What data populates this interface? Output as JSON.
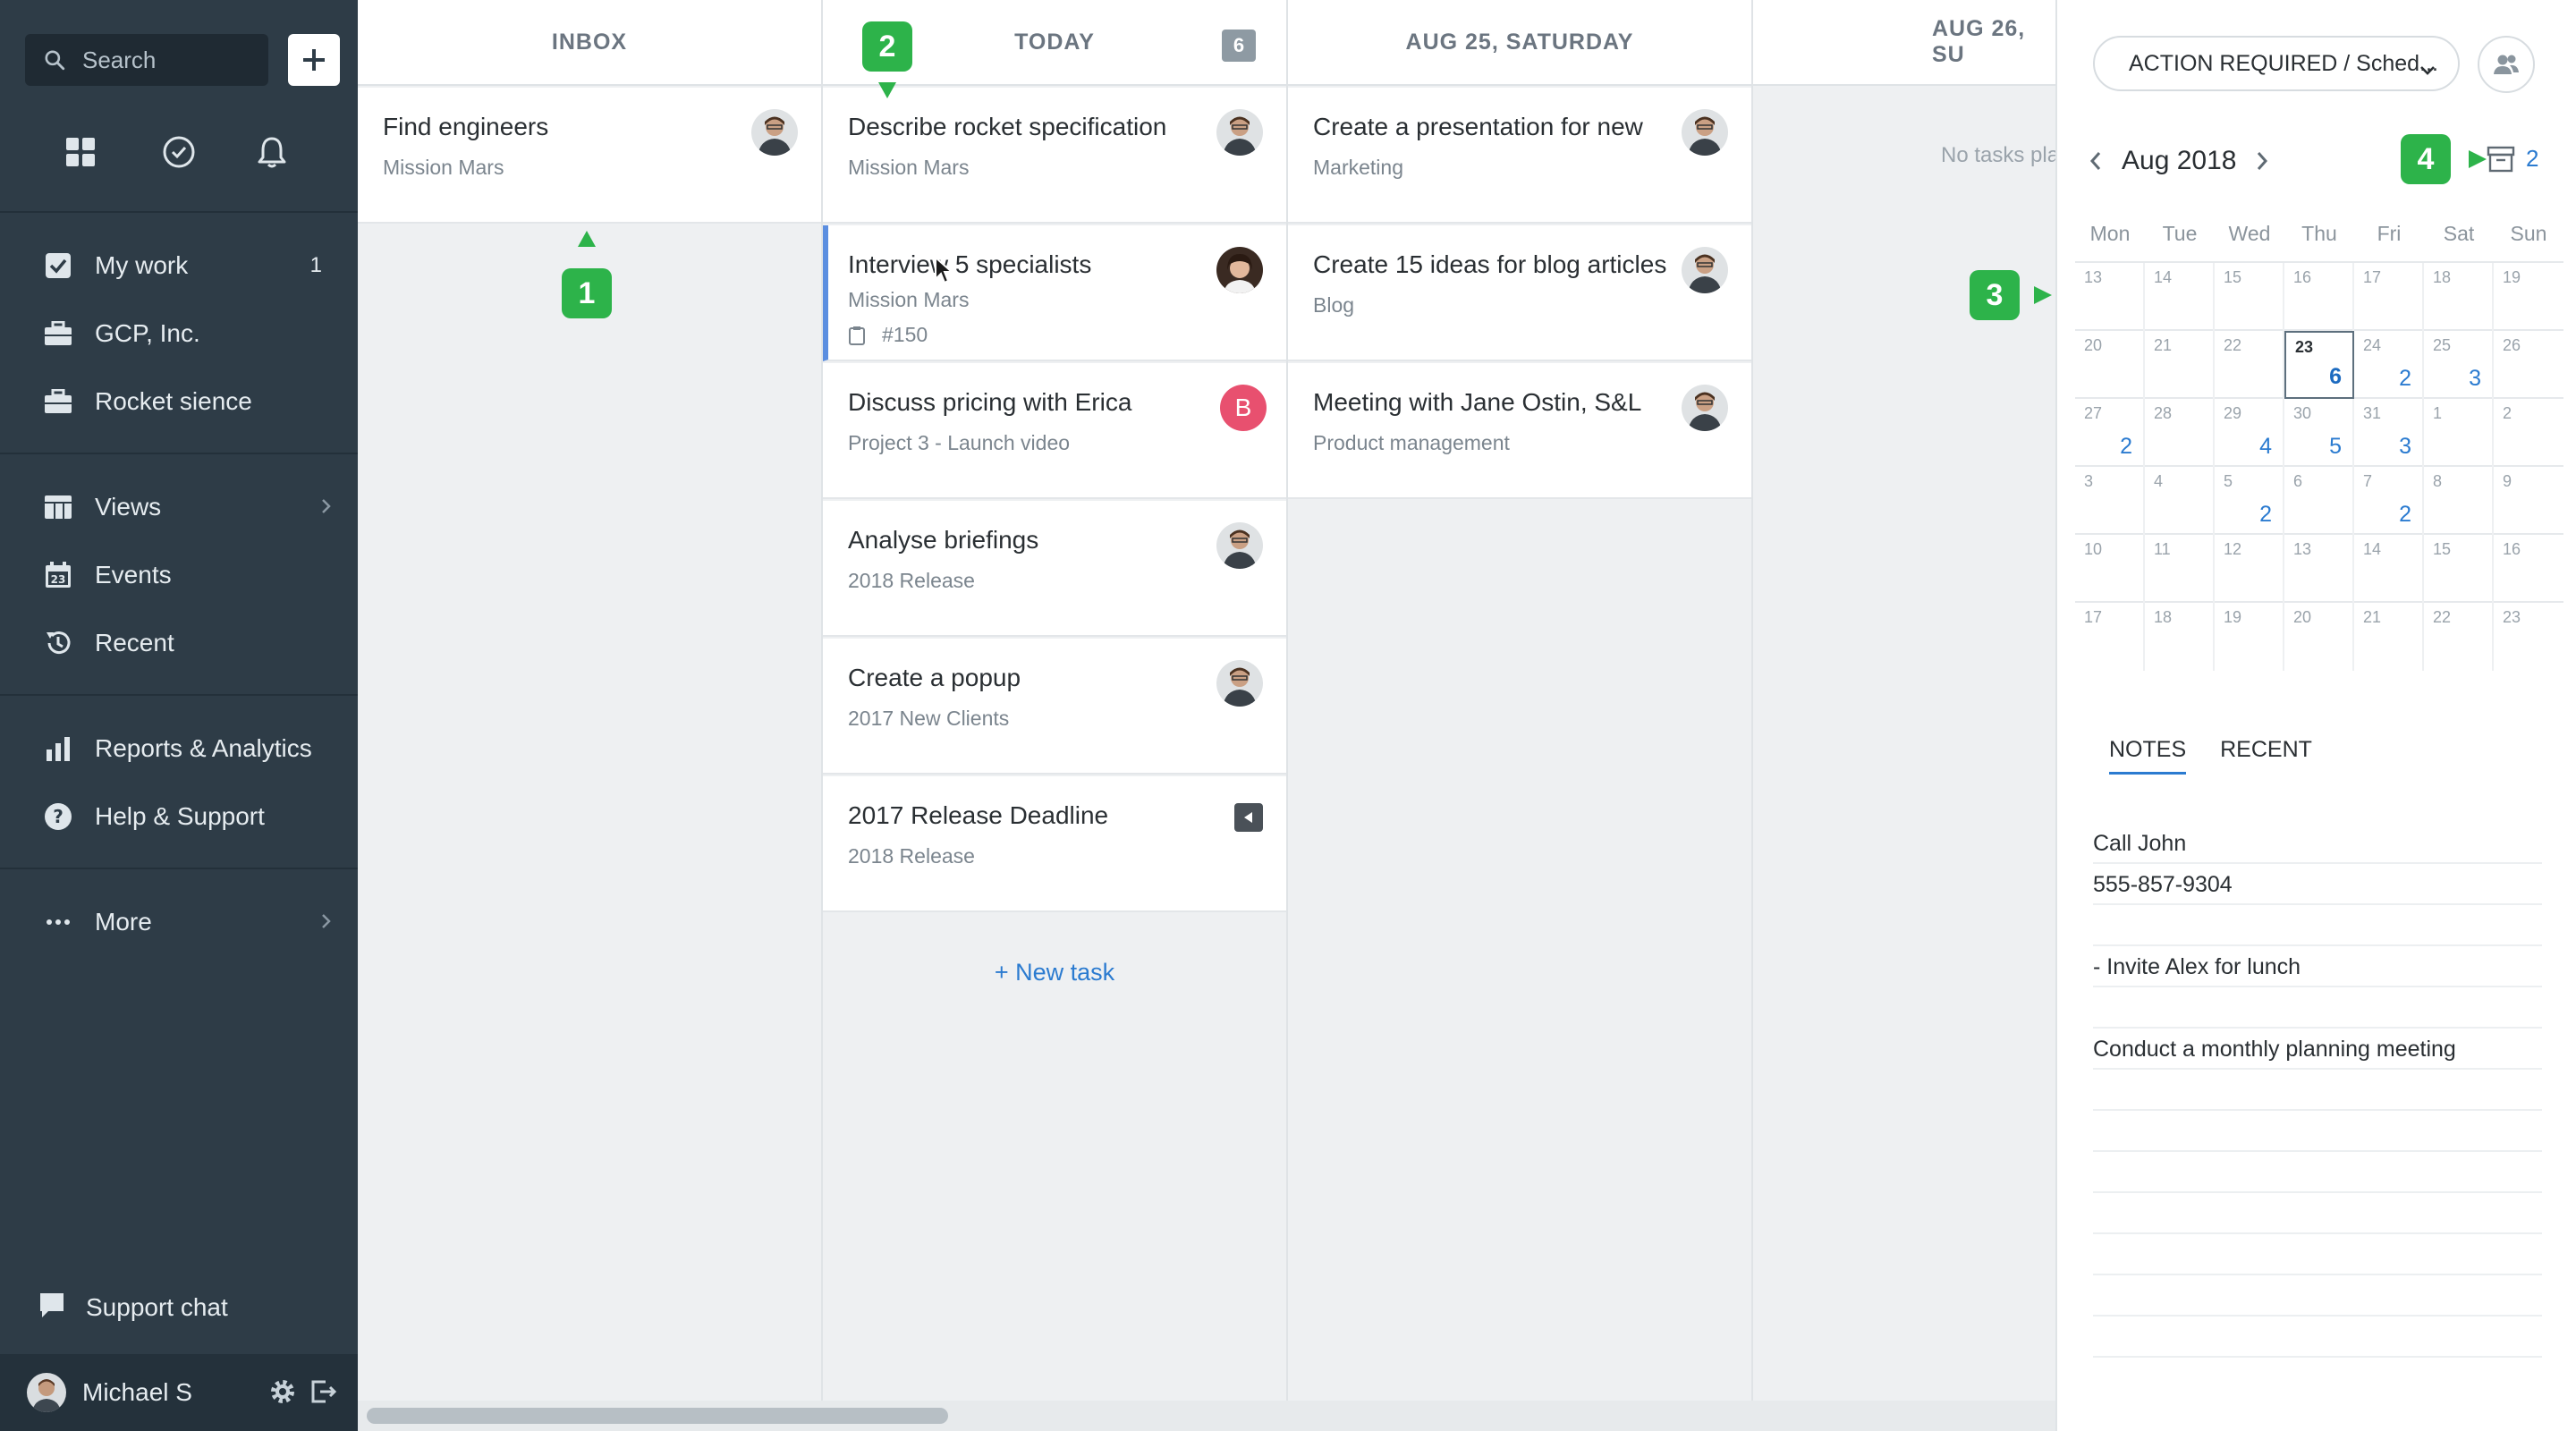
{
  "sidebar": {
    "search_placeholder": "Search",
    "nav": [
      {
        "label": "My work",
        "count": "1"
      },
      {
        "label": "GCP, Inc."
      },
      {
        "label": "Rocket sience"
      },
      {
        "label": "Views"
      },
      {
        "label": "Events"
      },
      {
        "label": "Recent"
      },
      {
        "label": "Reports & Analytics"
      },
      {
        "label": "Help & Support"
      },
      {
        "label": "More"
      }
    ],
    "support_chat": "Support chat",
    "user_name": "Michael S"
  },
  "board": {
    "columns": [
      {
        "title": "INBOX"
      },
      {
        "title": "TODAY",
        "count": "6"
      },
      {
        "title": "AUG 25, SATURDAY"
      },
      {
        "title": "AUG 26, SU"
      }
    ],
    "inbox_cards": [
      {
        "title": "Find engineers",
        "project": "Mission Mars"
      }
    ],
    "today_cards": [
      {
        "title": "Describe rocket specification",
        "project": "Mission Mars"
      },
      {
        "title": "Interview 5 specialists",
        "project": "Mission Mars",
        "id": "#150"
      },
      {
        "title": "Discuss pricing with Erica",
        "project": "Project 3 - Launch video",
        "avatar_letter": "B"
      },
      {
        "title": "Analyse briefings",
        "project": "2018 Release"
      },
      {
        "title": "Create a popup",
        "project": "2017 New Clients"
      },
      {
        "title": "2017 Release Deadline",
        "project": "2018 Release"
      }
    ],
    "saturday_cards": [
      {
        "title": "Create a presentation for new",
        "project": "Marketing"
      },
      {
        "title": "Create 15 ideas for blog articles",
        "project": "Blog"
      },
      {
        "title": "Meeting with Jane Ostin, S&L",
        "project": "Product management"
      }
    ],
    "sunday_empty": "No tasks pla",
    "new_task": "+ New task",
    "markers": [
      "1",
      "2",
      "3",
      "4"
    ]
  },
  "panel": {
    "filter_label": "ACTION REQUIRED / Sched...",
    "month": "Aug 2018",
    "archive_count": "2",
    "weekdays": [
      "Mon",
      "Tue",
      "Wed",
      "Thu",
      "Fri",
      "Sat",
      "Sun"
    ],
    "weeks": [
      [
        {
          "d": "13"
        },
        {
          "d": "14"
        },
        {
          "d": "15"
        },
        {
          "d": "16"
        },
        {
          "d": "17"
        },
        {
          "d": "18"
        },
        {
          "d": "19"
        }
      ],
      [
        {
          "d": "20"
        },
        {
          "d": "21"
        },
        {
          "d": "22"
        },
        {
          "d": "23",
          "n": "6",
          "today": true
        },
        {
          "d": "24",
          "n": "2"
        },
        {
          "d": "25",
          "n": "3"
        },
        {
          "d": "26"
        }
      ],
      [
        {
          "d": "27",
          "n": "2"
        },
        {
          "d": "28"
        },
        {
          "d": "29",
          "n": "4"
        },
        {
          "d": "30",
          "n": "5"
        },
        {
          "d": "31",
          "n": "3"
        },
        {
          "d": "1"
        },
        {
          "d": "2"
        }
      ],
      [
        {
          "d": "3"
        },
        {
          "d": "4"
        },
        {
          "d": "5",
          "n": "2"
        },
        {
          "d": "6"
        },
        {
          "d": "7",
          "n": "2"
        },
        {
          "d": "8"
        },
        {
          "d": "9"
        }
      ],
      [
        {
          "d": "10"
        },
        {
          "d": "11"
        },
        {
          "d": "12"
        },
        {
          "d": "13"
        },
        {
          "d": "14"
        },
        {
          "d": "15"
        },
        {
          "d": "16"
        }
      ],
      [
        {
          "d": "17"
        },
        {
          "d": "18"
        },
        {
          "d": "19"
        },
        {
          "d": "20"
        },
        {
          "d": "21"
        },
        {
          "d": "22"
        },
        {
          "d": "23"
        }
      ]
    ],
    "tabs": [
      "NOTES",
      "RECENT"
    ],
    "notes": [
      "Call John",
      "555-857-9304",
      "",
      "- Invite Alex for lunch",
      "",
      "Conduct a monthly planning meeting",
      "",
      "",
      "",
      "",
      "",
      "",
      ""
    ]
  },
  "colors": {
    "sidebar_bg": "#2e3c47",
    "accent": "#2b7bd0",
    "marker": "#2db34a",
    "selected": "#5b8ee0"
  }
}
